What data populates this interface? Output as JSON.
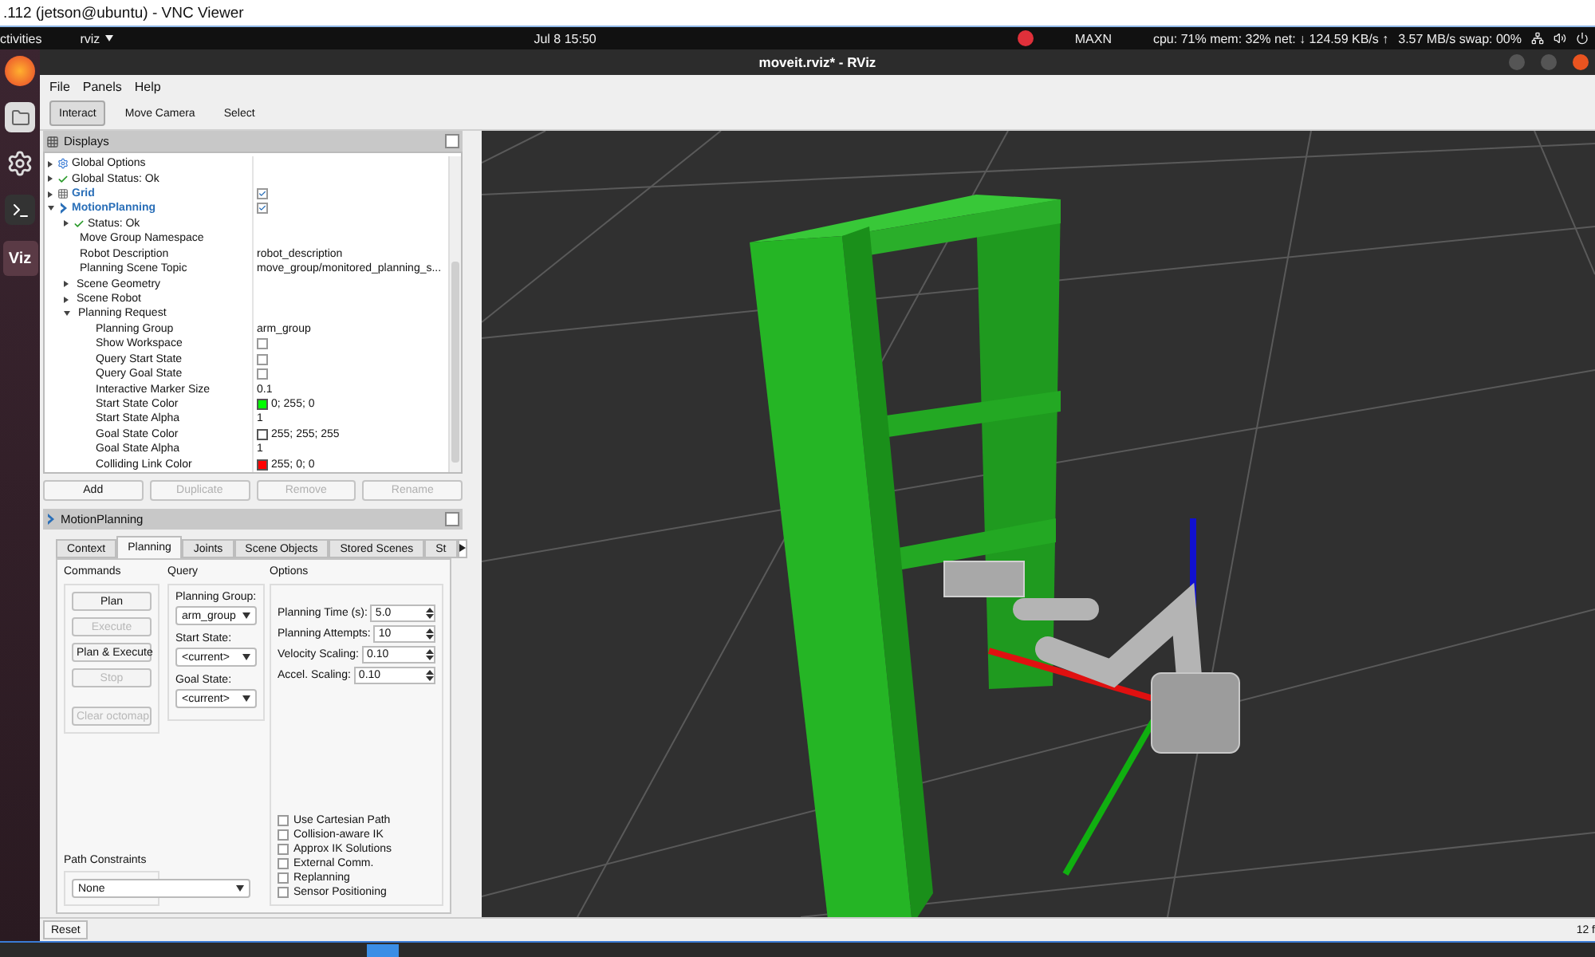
{
  "vnc_title": ".112 (jetson@ubuntu) - VNC Viewer",
  "topbar": {
    "activities": "ctivities",
    "app": "rviz",
    "clock": "Jul 8  15:50",
    "gpu_mode": "MAXN",
    "cpu": "cpu: 71% mem: 32% net: ↓ 124.59 KB/s ↑",
    "swap": "3.57 MB/s swap: 00%"
  },
  "dock_app_label": "Viz",
  "window": {
    "title": "moveit.rviz* - RViz"
  },
  "menu": [
    "File",
    "Panels",
    "Help"
  ],
  "tools": [
    {
      "label": "Interact",
      "selected": true
    },
    {
      "label": "Move Camera",
      "selected": false
    },
    {
      "label": "Select",
      "selected": false
    }
  ],
  "displays": {
    "title": "Displays",
    "tree": [
      {
        "label": "Global Options",
        "kind": "options",
        "expanded": false
      },
      {
        "label": "Global Status: Ok",
        "kind": "status",
        "expanded": false
      },
      {
        "label": "Grid",
        "kind": "grid",
        "expanded": false,
        "checked": true
      },
      {
        "label": "MotionPlanning",
        "kind": "plugin",
        "expanded": true,
        "checked": true,
        "children": [
          {
            "label": "Status: Ok",
            "kind": "status",
            "expanded": false
          },
          {
            "label": "Move Group Namespace"
          },
          {
            "label": "Robot Description",
            "value": "robot_description"
          },
          {
            "label": "Planning Scene Topic",
            "value": "move_group/monitored_planning_s..."
          },
          {
            "label": "Scene Geometry",
            "expanded": false
          },
          {
            "label": "Scene Robot",
            "expanded": false
          },
          {
            "label": "Planning Request",
            "expanded": true,
            "children": [
              {
                "label": "Planning Group",
                "value": "arm_group"
              },
              {
                "label": "Show Workspace",
                "checked": false
              },
              {
                "label": "Query Start State",
                "checked": false
              },
              {
                "label": "Query Goal State",
                "checked": false
              },
              {
                "label": "Interactive Marker Size",
                "value": "0.1"
              },
              {
                "label": "Start State Color",
                "value": "0; 255; 0",
                "color": "#00ff00"
              },
              {
                "label": "Start State Alpha",
                "value": "1"
              },
              {
                "label": "Goal State Color",
                "value": "255; 255; 255",
                "color": "#ffffff"
              },
              {
                "label": "Goal State Alpha",
                "value": "1"
              },
              {
                "label": "Colliding Link Color",
                "value": "255; 0; 0",
                "color": "#ff0000"
              }
            ]
          }
        ]
      }
    ]
  },
  "display_buttons": [
    {
      "label": "Add",
      "disabled": false
    },
    {
      "label": "Duplicate",
      "disabled": true
    },
    {
      "label": "Remove",
      "disabled": true
    },
    {
      "label": "Rename",
      "disabled": true
    }
  ],
  "motion_panel": {
    "title": "MotionPlanning",
    "tabs": [
      {
        "label": "Context",
        "selected": false
      },
      {
        "label": "Planning",
        "selected": true
      },
      {
        "label": "Joints",
        "selected": false
      },
      {
        "label": "Scene Objects",
        "selected": false
      },
      {
        "label": "Stored Scenes",
        "selected": false
      },
      {
        "label": "St",
        "selected": false
      }
    ],
    "commands": {
      "title": "Commands",
      "buttons": [
        {
          "label": "Plan",
          "disabled": false
        },
        {
          "label": "Execute",
          "disabled": true
        },
        {
          "label": "Plan & Execute",
          "disabled": false
        },
        {
          "label": "Stop",
          "disabled": true
        },
        {
          "label": "Clear octomap",
          "disabled": true
        }
      ]
    },
    "query": {
      "title": "Query",
      "fields": [
        {
          "label": "Planning Group:",
          "value": "arm_group"
        },
        {
          "label": "Start State:",
          "value": "<current>"
        },
        {
          "label": "Goal State:",
          "value": "<current>"
        }
      ]
    },
    "options": {
      "title": "Options",
      "spinboxes": [
        {
          "label": "Planning Time (s):",
          "value": "5.0"
        },
        {
          "label": "Planning Attempts:",
          "value": "10"
        },
        {
          "label": "Velocity Scaling:",
          "value": "0.10"
        },
        {
          "label": "Accel. Scaling:",
          "value": "0.10"
        }
      ],
      "checkboxes": [
        {
          "label": "Use Cartesian Path",
          "checked": false
        },
        {
          "label": "Collision-aware IK",
          "checked": false
        },
        {
          "label": "Approx IK Solutions",
          "checked": false
        },
        {
          "label": "External Comm.",
          "checked": false
        },
        {
          "label": "Replanning",
          "checked": false
        },
        {
          "label": "Sensor Positioning",
          "checked": false
        }
      ]
    },
    "path_constraints": {
      "label": "Path Constraints",
      "value": "None"
    }
  },
  "status_bar": {
    "reset": "Reset",
    "fps": "12 f"
  }
}
